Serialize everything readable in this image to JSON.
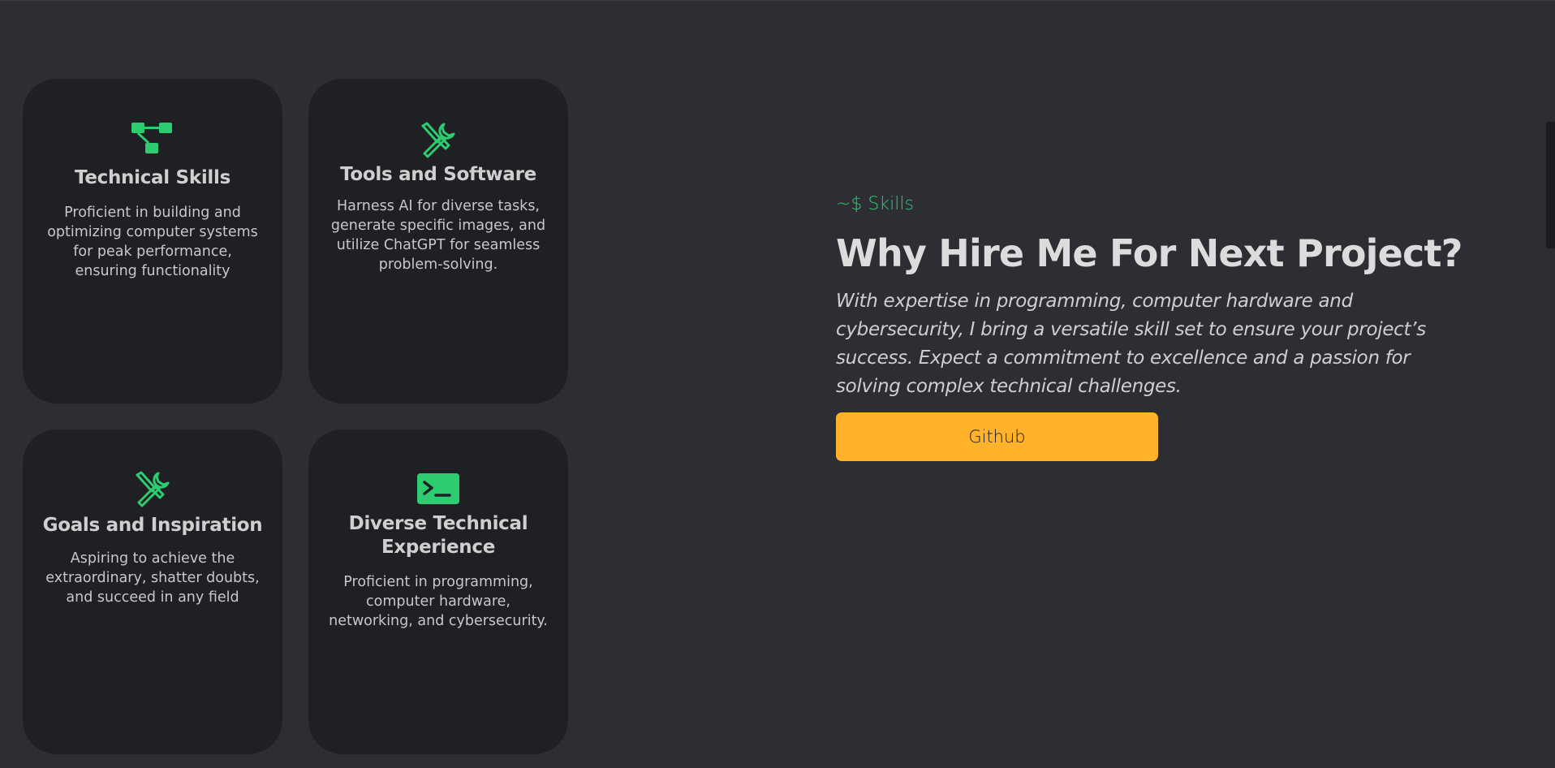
{
  "cards": [
    {
      "icon": "flowchart-icon",
      "title": "Technical Skills",
      "text": "Proficient in building and optimizing computer systems for peak performance, ensuring functionality"
    },
    {
      "icon": "tools-icon",
      "title": "Tools and Software",
      "text": "Harness AI for diverse tasks, generate specific images, and utilize ChatGPT for seamless problem-solving."
    },
    {
      "icon": "tools-icon",
      "title": "Goals and Inspiration",
      "text": "Aspiring to achieve the extraordinary, shatter doubts, and succeed in any field"
    },
    {
      "icon": "terminal-icon",
      "title": "Diverse Technical Experience",
      "text": "Proficient in programming, computer hardware, networking, and cybersecurity."
    }
  ],
  "hero": {
    "kicker": "~$ Skills",
    "title": "Why Hire Me For Next Project?",
    "description": "With expertise in programming, computer hardware and cybersecurity, I bring a versatile skill set to ensure your project’s success. Expect a commitment to excellence and a passion for solving complex technical challenges.",
    "button_label": "Github"
  },
  "colors": {
    "background": "#2d2e33",
    "card": "#1f2024",
    "accent_green": "#2ecc71",
    "button": "#ffb22a"
  }
}
